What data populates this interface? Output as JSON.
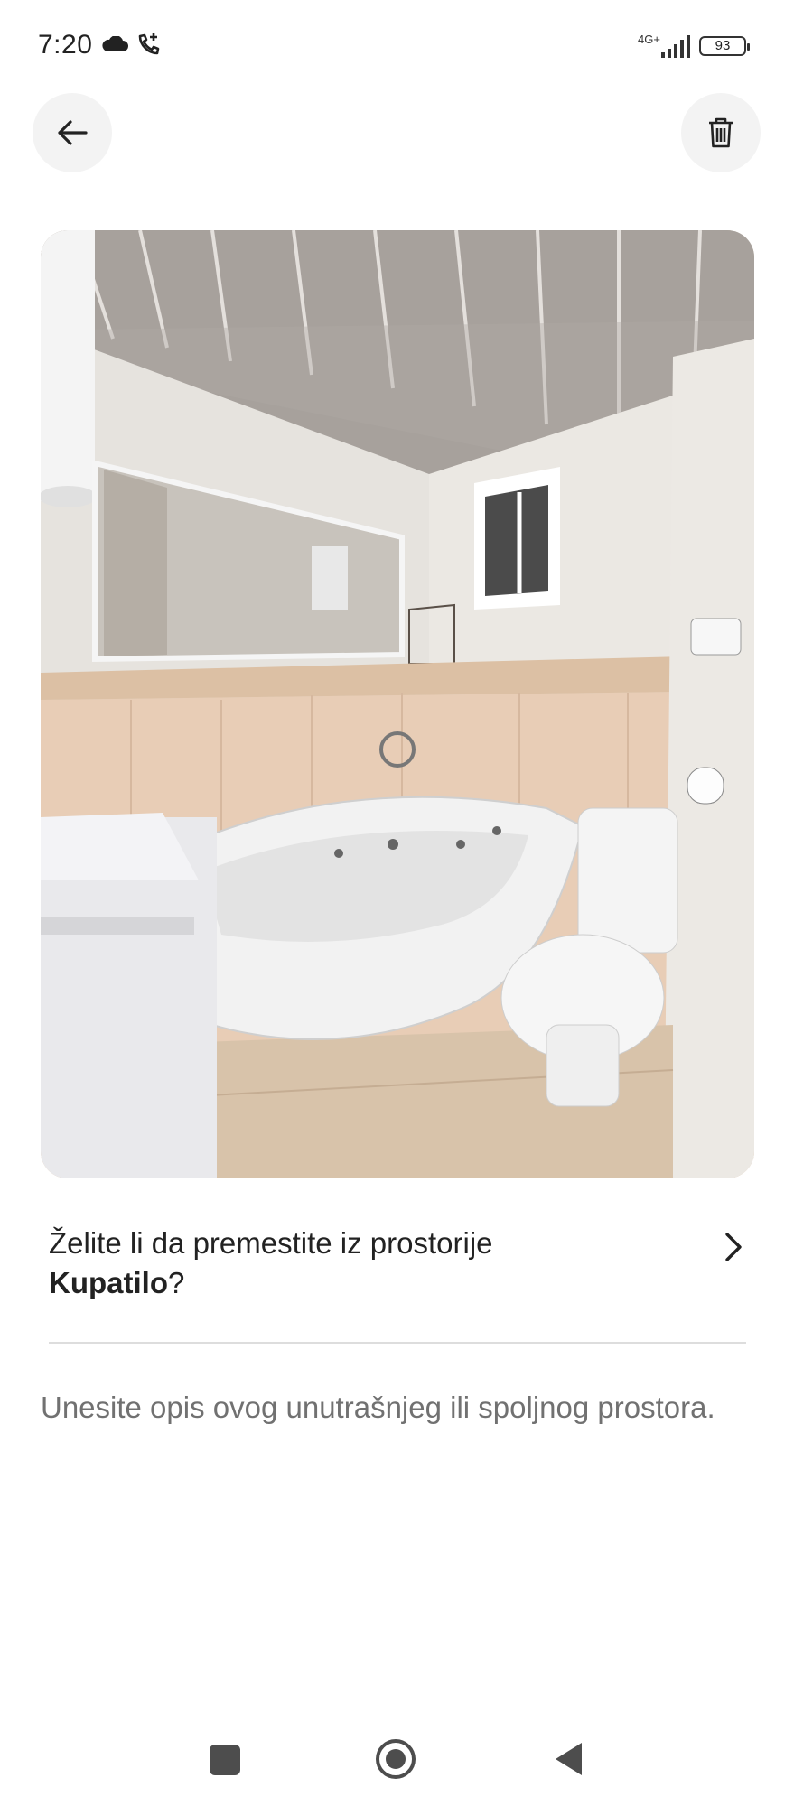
{
  "status_bar": {
    "time": "7:20",
    "network": "4G+",
    "battery": "93"
  },
  "header": {
    "back_icon": "arrow-left-icon",
    "delete_icon": "trash-icon"
  },
  "photo": {
    "subject": "bathroom"
  },
  "move_prompt": {
    "text_before": "Želite li da premestite iz prostorije ",
    "room": "Kupatilo",
    "text_after": "?"
  },
  "description": {
    "placeholder": "Unesite opis ovog unutrašnjeg ili spoljnog prostora."
  },
  "nav_bar": {
    "recents_icon": "square-icon",
    "home_icon": "home-circle-icon",
    "back_icon": "triangle-back-icon"
  },
  "colors": {
    "button_bg": "#f3f3f3",
    "text_primary": "#222222",
    "text_secondary": "#717171",
    "divider": "#dddddd"
  }
}
